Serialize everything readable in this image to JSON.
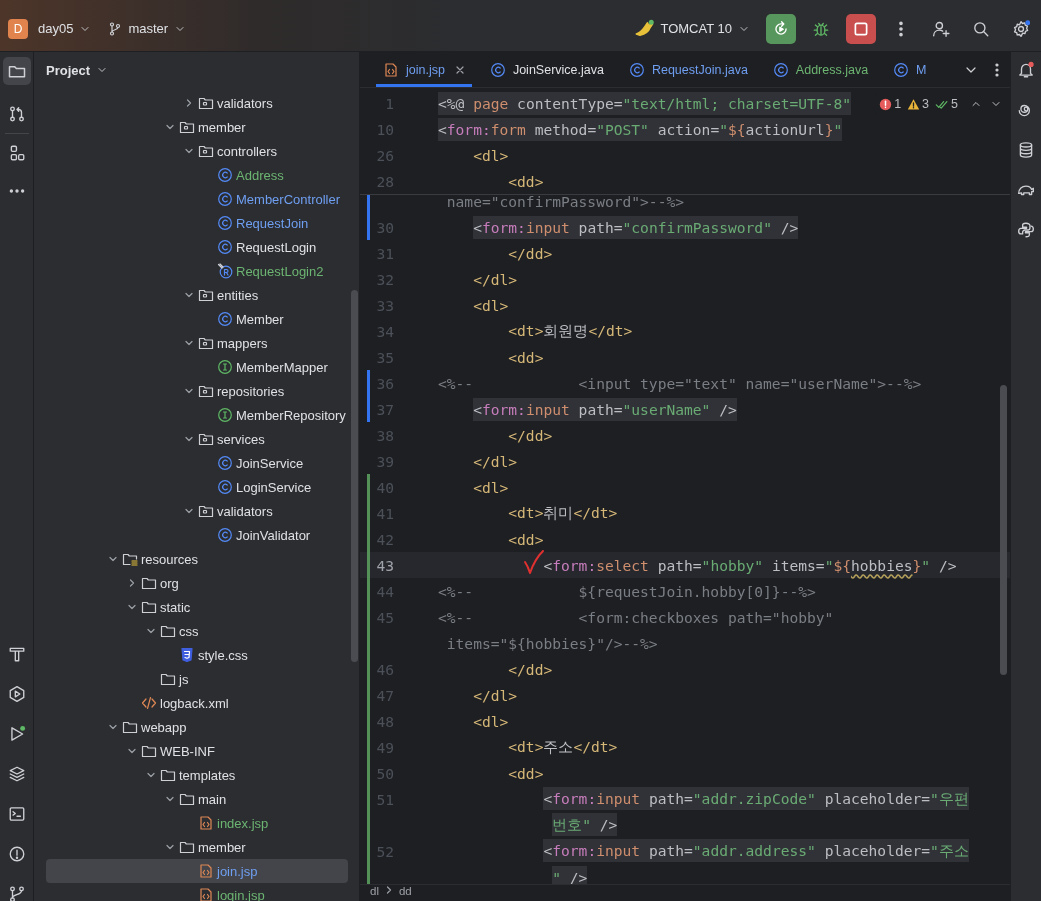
{
  "header": {
    "project_badge": "D",
    "project": "day05",
    "branch": "master",
    "run_config": "TOMCAT 10"
  },
  "project": {
    "title": "Project",
    "tree": [
      {
        "children": [
          {
            "children": [
              {
                "children": [
                  {
                    "children": [
                      {
                        "label": "validators",
                        "kind": "package",
                        "expanded": false,
                        "selected": false
                      }
                    ]
                  },
                  {
                    "label": "member",
                    "kind": "package",
                    "expanded": true,
                    "selected": false,
                    "children": [
                      {
                        "label": "controllers",
                        "kind": "package",
                        "expanded": true,
                        "selected": false,
                        "children": [
                          {
                            "label": "Address",
                            "kind": "class",
                            "selected": false,
                            "color": "#6cb472"
                          },
                          {
                            "label": "MemberController",
                            "kind": "class",
                            "selected": false,
                            "color": "#6f9ff2"
                          },
                          {
                            "label": "RequestJoin",
                            "kind": "class",
                            "selected": false,
                            "color": "#6f9ff2"
                          },
                          {
                            "label": "RequestLogin",
                            "kind": "class",
                            "selected": false
                          },
                          {
                            "label": "RequestLogin2",
                            "kind": "record",
                            "selected": false,
                            "color": "#6cb472"
                          }
                        ]
                      },
                      {
                        "label": "entities",
                        "kind": "package",
                        "expanded": true,
                        "selected": false,
                        "children": [
                          {
                            "label": "Member",
                            "kind": "class",
                            "selected": false
                          }
                        ]
                      },
                      {
                        "label": "mappers",
                        "kind": "package",
                        "expanded": true,
                        "selected": false,
                        "children": [
                          {
                            "label": "MemberMapper",
                            "kind": "interface",
                            "selected": false
                          }
                        ]
                      },
                      {
                        "label": "repositories",
                        "kind": "package",
                        "expanded": true,
                        "selected": false,
                        "children": [
                          {
                            "label": "MemberRepository",
                            "kind": "interface",
                            "selected": false
                          }
                        ]
                      },
                      {
                        "label": "services",
                        "kind": "package",
                        "expanded": true,
                        "selected": false,
                        "children": [
                          {
                            "label": "JoinService",
                            "kind": "class",
                            "selected": false
                          },
                          {
                            "label": "LoginService",
                            "kind": "class",
                            "selected": false
                          }
                        ]
                      },
                      {
                        "label": "validators",
                        "kind": "package",
                        "expanded": true,
                        "selected": false,
                        "children": [
                          {
                            "label": "JoinValidator",
                            "kind": "class",
                            "selected": false
                          }
                        ]
                      }
                    ]
                  }
                ]
              }
            ]
          }
        ]
      },
      {
        "label": "resources",
        "kind": "resources",
        "expanded": true,
        "selected": false,
        "children": [
          {
            "label": "org",
            "kind": "folder",
            "expanded": false,
            "selected": false
          },
          {
            "label": "static",
            "kind": "folder",
            "expanded": true,
            "selected": false,
            "children": [
              {
                "label": "css",
                "kind": "folder",
                "expanded": true,
                "selected": false,
                "children": [
                  {
                    "label": "style.css",
                    "kind": "css",
                    "selected": false
                  }
                ]
              },
              {
                "label": "js",
                "kind": "folder",
                "selected": false
              }
            ]
          },
          {
            "label": "logback.xml",
            "kind": "xml",
            "selected": false
          }
        ]
      },
      {
        "label": "webapp",
        "kind": "folder",
        "expanded": true,
        "selected": false,
        "children": [
          {
            "label": "WEB-INF",
            "kind": "folder",
            "expanded": true,
            "selected": false,
            "children": [
              {
                "label": "templates",
                "kind": "folder",
                "expanded": true,
                "selected": false,
                "children": [
                  {
                    "label": "main",
                    "kind": "folder",
                    "expanded": true,
                    "selected": false,
                    "children": [
                      {
                        "label": "index.jsp",
                        "kind": "jsp",
                        "selected": false,
                        "color": "#6cb472"
                      }
                    ]
                  },
                  {
                    "label": "member",
                    "kind": "folder",
                    "expanded": true,
                    "selected": false,
                    "children": [
                      {
                        "label": "join.jsp",
                        "kind": "jsp",
                        "selected": true,
                        "color": "#6f9ff2"
                      },
                      {
                        "label": "login.jsp",
                        "kind": "jsp",
                        "selected": false,
                        "color": "#6cb472"
                      }
                    ]
                  }
                ]
              }
            ]
          }
        ]
      }
    ]
  },
  "tabs": [
    {
      "label": "join.jsp",
      "kind": "jsp",
      "selected": true,
      "color": "#6f9ff2"
    },
    {
      "label": "JoinService.java",
      "kind": "class",
      "selected": false
    },
    {
      "label": "RequestJoin.java",
      "kind": "class",
      "selected": false,
      "color": "#6f9ff2"
    },
    {
      "label": "Address.java",
      "kind": "class",
      "selected": false,
      "color": "#6cb472"
    },
    {
      "label": "M",
      "kind": "class",
      "selected": false,
      "color": "#6f9ff2"
    }
  ],
  "inspections": {
    "errors": "1",
    "warnings": "3",
    "passed": "5"
  },
  "sticky_lines": [
    {
      "number": "1",
      "highlight": true,
      "tokens": [
        {
          "kind": "plain",
          "text": "<%@ "
        },
        {
          "kind": "keyword",
          "text": "page"
        },
        {
          "kind": "plain",
          "text": " contentType="
        },
        {
          "kind": "string",
          "text": "\"text/html; charset=UTF-8\""
        }
      ]
    },
    {
      "number": "10",
      "highlight": true,
      "tokens": [
        {
          "kind": "plain",
          "text": "<"
        },
        {
          "kind": "prefix",
          "text": "form:"
        },
        {
          "kind": "keyword",
          "text": "form"
        },
        {
          "kind": "plain",
          "text": " method="
        },
        {
          "kind": "string",
          "text": "\"POST\""
        },
        {
          "kind": "plain",
          "text": " action="
        },
        {
          "kind": "string",
          "text": "\""
        },
        {
          "kind": "keyword",
          "text": "${"
        },
        {
          "kind": "plain",
          "text": "actionUrl"
        },
        {
          "kind": "keyword",
          "text": "}"
        },
        {
          "kind": "string",
          "text": "\""
        }
      ]
    },
    {
      "number": "26",
      "highlight": false,
      "tokens": [
        {
          "kind": "tag",
          "text": "    <dl>"
        }
      ]
    },
    {
      "number": "28",
      "highlight": false,
      "tokens": [
        {
          "kind": "tag",
          "text": "        <dd>"
        }
      ]
    }
  ],
  "lines": [
    {
      "highlight": false,
      "current": false,
      "annotated": false,
      "color": "#3574f0",
      "tokens": [
        {
          "kind": "comment",
          "text": " name=\"confirmPassword\">--%>"
        }
      ]
    },
    {
      "number": "30",
      "highlight": true,
      "current": false,
      "annotated": false,
      "color": "#3574f0",
      "tokens": [
        {
          "kind": "plain",
          "text": "    <"
        },
        {
          "kind": "prefix",
          "text": "form:"
        },
        {
          "kind": "keyword",
          "text": "input"
        },
        {
          "kind": "plain",
          "text": " path="
        },
        {
          "kind": "string",
          "text": "\"confirmPassword\""
        },
        {
          "kind": "plain",
          "text": " />"
        }
      ]
    },
    {
      "number": "31",
      "highlight": false,
      "current": false,
      "annotated": false,
      "tokens": [
        {
          "kind": "tag",
          "text": "        </dd>"
        }
      ]
    },
    {
      "number": "32",
      "highlight": false,
      "current": false,
      "annotated": false,
      "tokens": [
        {
          "kind": "tag",
          "text": "    </dl>"
        }
      ]
    },
    {
      "number": "33",
      "highlight": false,
      "current": false,
      "annotated": false,
      "tokens": [
        {
          "kind": "tag",
          "text": "    <dl>"
        }
      ]
    },
    {
      "number": "34",
      "highlight": false,
      "current": false,
      "annotated": false,
      "tokens": [
        {
          "kind": "tag",
          "text": "        <dt>"
        },
        {
          "kind": "plain",
          "text": "회원명"
        },
        {
          "kind": "tag",
          "text": "</dt>"
        }
      ]
    },
    {
      "number": "35",
      "highlight": false,
      "current": false,
      "annotated": false,
      "tokens": [
        {
          "kind": "tag",
          "text": "        <dd>"
        }
      ]
    },
    {
      "number": "36",
      "highlight": false,
      "current": false,
      "annotated": false,
      "color": "#3574f0",
      "tokens": [
        {
          "kind": "comment",
          "text": "<%--            <input type=\"text\" name=\"userName\">--%>"
        }
      ]
    },
    {
      "number": "37",
      "highlight": true,
      "current": false,
      "annotated": false,
      "color": "#3574f0",
      "tokens": [
        {
          "kind": "plain",
          "text": "    <"
        },
        {
          "kind": "prefix",
          "text": "form:"
        },
        {
          "kind": "keyword",
          "text": "input"
        },
        {
          "kind": "plain",
          "text": " path="
        },
        {
          "kind": "string",
          "text": "\"userName\""
        },
        {
          "kind": "plain",
          "text": " />"
        }
      ]
    },
    {
      "number": "38",
      "highlight": false,
      "current": false,
      "annotated": false,
      "tokens": [
        {
          "kind": "tag",
          "text": "        </dd>"
        }
      ]
    },
    {
      "number": "39",
      "highlight": false,
      "current": false,
      "annotated": false,
      "tokens": [
        {
          "kind": "tag",
          "text": "    </dl>"
        }
      ]
    },
    {
      "number": "40",
      "highlight": false,
      "current": false,
      "annotated": false,
      "color": "#549159",
      "tokens": [
        {
          "kind": "tag",
          "text": "    <dl>"
        }
      ]
    },
    {
      "number": "41",
      "highlight": false,
      "current": false,
      "annotated": false,
      "color": "#549159",
      "tokens": [
        {
          "kind": "tag",
          "text": "        <dt>"
        },
        {
          "kind": "plain",
          "text": "취미"
        },
        {
          "kind": "tag",
          "text": "</dt>"
        }
      ]
    },
    {
      "number": "42",
      "highlight": false,
      "current": false,
      "annotated": false,
      "color": "#549159",
      "tokens": [
        {
          "kind": "tag",
          "text": "        <dd>"
        }
      ]
    },
    {
      "number": "43",
      "highlight": false,
      "current": true,
      "annotated": true,
      "color": "#549159",
      "tokens": [
        {
          "kind": "plain",
          "text": "            <"
        },
        {
          "kind": "prefix",
          "text": "form:"
        },
        {
          "kind": "keyword",
          "text": "select"
        },
        {
          "kind": "plain",
          "text": " path="
        },
        {
          "kind": "string",
          "text": "\"hobby\""
        },
        {
          "kind": "plain",
          "text": " items="
        },
        {
          "kind": "string",
          "text": "\""
        },
        {
          "kind": "keyword",
          "text": "${"
        },
        {
          "kind": "typo",
          "text": "hobbies"
        },
        {
          "kind": "keyword",
          "text": "}"
        },
        {
          "kind": "string",
          "text": "\""
        },
        {
          "kind": "plain",
          "text": " />"
        }
      ]
    },
    {
      "number": "44",
      "highlight": false,
      "current": false,
      "annotated": false,
      "color": "#549159",
      "tokens": [
        {
          "kind": "comment",
          "text": "<%--            ${requestJoin.hobby[0]}--%>"
        }
      ]
    },
    {
      "number": "45",
      "highlight": false,
      "current": false,
      "annotated": false,
      "color": "#549159",
      "tokens": [
        {
          "kind": "comment",
          "text": "<%--            <form:checkboxes path=\"hobby\""
        }
      ]
    },
    {
      "highlight": false,
      "current": false,
      "annotated": false,
      "color": "#549159",
      "tokens": [
        {
          "kind": "comment",
          "text": " items=\"${hobbies}\"/>--%>"
        }
      ]
    },
    {
      "number": "46",
      "highlight": false,
      "current": false,
      "annotated": false,
      "color": "#549159",
      "tokens": [
        {
          "kind": "tag",
          "text": "        </dd>"
        }
      ]
    },
    {
      "number": "47",
      "highlight": false,
      "current": false,
      "annotated": false,
      "color": "#549159",
      "tokens": [
        {
          "kind": "tag",
          "text": "    </dl>"
        }
      ]
    },
    {
      "number": "48",
      "highlight": false,
      "current": false,
      "annotated": false,
      "color": "#549159",
      "tokens": [
        {
          "kind": "tag",
          "text": "    <dl>"
        }
      ]
    },
    {
      "number": "49",
      "highlight": false,
      "current": false,
      "annotated": false,
      "color": "#549159",
      "tokens": [
        {
          "kind": "tag",
          "text": "        <dt>"
        },
        {
          "kind": "plain",
          "text": "주소"
        },
        {
          "kind": "tag",
          "text": "</dt>"
        }
      ]
    },
    {
      "number": "50",
      "highlight": false,
      "current": false,
      "annotated": false,
      "color": "#549159",
      "tokens": [
        {
          "kind": "tag",
          "text": "        <dd>"
        }
      ]
    },
    {
      "number": "51",
      "highlight": true,
      "current": false,
      "annotated": false,
      "color": "#549159",
      "tokens": [
        {
          "kind": "plain",
          "text": "            <"
        },
        {
          "kind": "prefix",
          "text": "form:"
        },
        {
          "kind": "keyword",
          "text": "input"
        },
        {
          "kind": "plain",
          "text": " path="
        },
        {
          "kind": "string",
          "text": "\"addr.zipCode\""
        },
        {
          "kind": "plain",
          "text": " placeholder="
        },
        {
          "kind": "string",
          "text": "\"우편"
        }
      ]
    },
    {
      "highlight": true,
      "current": false,
      "annotated": false,
      "color": "#549159",
      "tokens": [
        {
          "kind": "string",
          "text": "             번호\""
        },
        {
          "kind": "plain",
          "text": " />"
        }
      ]
    },
    {
      "number": "52",
      "highlight": true,
      "current": false,
      "annotated": false,
      "color": "#549159",
      "tokens": [
        {
          "kind": "plain",
          "text": "            <"
        },
        {
          "kind": "prefix",
          "text": "form:"
        },
        {
          "kind": "keyword",
          "text": "input"
        },
        {
          "kind": "plain",
          "text": " path="
        },
        {
          "kind": "string",
          "text": "\"addr.address\""
        },
        {
          "kind": "plain",
          "text": " placeholder="
        },
        {
          "kind": "string",
          "text": "\"주소"
        }
      ]
    },
    {
      "highlight": true,
      "current": false,
      "annotated": false,
      "color": "#549159",
      "tokens": [
        {
          "kind": "string",
          "text": "             \""
        },
        {
          "kind": "plain",
          "text": " />"
        }
      ]
    }
  ],
  "breadcrumbs": [
    "dl",
    "dd"
  ]
}
